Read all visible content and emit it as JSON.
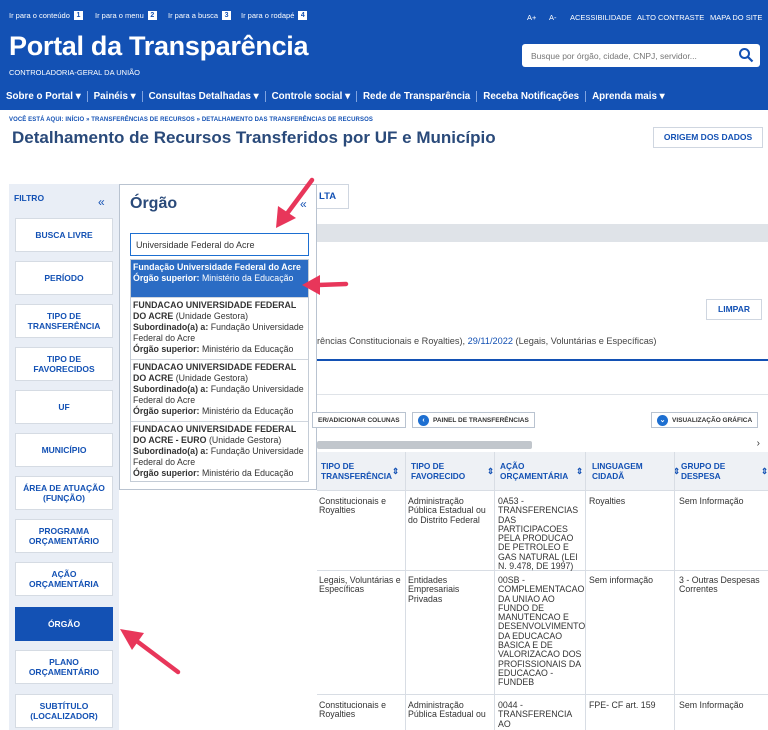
{
  "skip_links": [
    {
      "label": "Ir para o conteúdo",
      "key": "1"
    },
    {
      "label": "Ir para o menu",
      "key": "2"
    },
    {
      "label": "Ir para a busca",
      "key": "3"
    },
    {
      "label": "Ir para o rodapé",
      "key": "4"
    }
  ],
  "top_links": {
    "font_plus": "A+",
    "font_minus": "A-",
    "accessibility": "ACESSIBILIDADE",
    "contrast": "ALTO CONTRASTE",
    "sitemap": "MAPA DO SITE"
  },
  "brand": {
    "title": "Portal da Transparência",
    "org": "CONTROLADORIA-GERAL DA UNIÃO"
  },
  "search": {
    "placeholder": "Busque por órgão, cidade, CNPJ, servidor..."
  },
  "nav": [
    "Sobre o Portal",
    "Painéis",
    "Consultas Detalhadas",
    "Controle social",
    "Rede de Transparência",
    "Receba Notificações",
    "Aprenda mais"
  ],
  "breadcrumb": "VOCÊ ESTÁ AQUI: INÍCIO » TRANSFERÊNCIAS DE RECURSOS » DETALHAMENTO DAS TRANSFERÊNCIAS DE RECURSOS",
  "page_title": "Detalhamento de Recursos Transferidos por UF e Município",
  "origem_button": "ORIGEM DOS DADOS",
  "filter": {
    "title": "FILTRO",
    "items": [
      "BUSCA LIVRE",
      "PERÍODO",
      "TIPO DE TRANSFERÊNCIA",
      "TIPO DE FAVORECIDOS",
      "UF",
      "MUNICÍPIO",
      "ÁREA DE ATUAÇÃO (FUNÇÃO)",
      "PROGRAMA ORÇAMENTÁRIO",
      "AÇÃO ORÇAMENTÁRIA",
      "ÓRGÃO",
      "PLANO ORÇAMENTÁRIO",
      "SUBTÍTULO (LOCALIZADOR)"
    ],
    "active": "ÓRGÃO"
  },
  "orgao_panel": {
    "title": "Órgão",
    "input_value": "Universidade Federal do Acre",
    "options": [
      {
        "name": "Fundação Universidade Federal do Acre",
        "superior_label": "Órgão superior:",
        "superior": "Ministério da Educação",
        "selected": true
      },
      {
        "name": "FUNDACAO UNIVERSIDADE FEDERAL DO ACRE",
        "unit": "(Unidade Gestora)",
        "sub_label": "Subordinado(a) a:",
        "sub": "Fundação Universidade Federal do Acre",
        "superior_label": "Órgão superior:",
        "superior": "Ministério da Educação"
      },
      {
        "name": "FUNDACAO UNIVERSIDADE FEDERAL DO ACRE",
        "unit": "(Unidade Gestora)",
        "sub_label": "Subordinado(a) a:",
        "sub": "Fundação Universidade Federal do Acre",
        "superior_label": "Órgão superior:",
        "superior": "Ministério da Educação"
      },
      {
        "name": "FUNDACAO UNIVERSIDADE FEDERAL DO ACRE - EURO",
        "unit": "(Unidade Gestora)",
        "sub_label": "Subordinado(a) a:",
        "sub": "Fundação Universidade Federal do Acre",
        "superior_label": "Órgão superior:",
        "superior": "Ministério da Educação"
      }
    ]
  },
  "main": {
    "tab_label": "LTA",
    "limpar": "LIMPAR",
    "criteria_text": "rências Constitucionais e Royalties), ",
    "criteria_date": "29/11/2022",
    "criteria_rest": " (Legais, Voluntárias e Específicas)",
    "toolbar": {
      "columns": "ER/ADICIONAR COLUNAS",
      "panel": "PAINEL DE TRANSFERÊNCIAS",
      "graphic": "VISUALIZAÇÃO GRÁFICA"
    },
    "columns": [
      "TIPO DE TRANSFERÊNCIA",
      "TIPO DE FAVORECIDO",
      "AÇÃO ORÇAMENTÁRIA",
      "LINGUAGEM CIDADÃ",
      "GRUPO DE DESPESA"
    ],
    "rows": [
      [
        "Constitucionais e Royalties",
        "Administração Pública Estadual ou do Distrito Federal",
        "0A53 - TRANSFERENCIAS DAS PARTICIPACOES PELA PRODUCAO DE PETROLEO E GAS NATURAL (LEI N. 9.478, DE 1997)",
        "Royalties",
        "Sem Informação"
      ],
      [
        "Legais, Voluntárias e Específicas",
        "Entidades Empresariais Privadas",
        "00SB - COMPLEMENTACAO DA UNIAO AO FUNDO DE MANUTENCAO E DESENVOLVIMENTO DA EDUCACAO BASICA E DE VALORIZACAO DOS PROFISSIONAIS DA EDUCACAO - FUNDEB",
        "Sem informação",
        "3 - Outras Despesas Correntes"
      ],
      [
        "Constitucionais e Royalties",
        "Administração Pública Estadual ou",
        "0044 - TRANSFERENCIA AO",
        "FPE- CF art. 159",
        "Sem Informação"
      ]
    ]
  },
  "colors": {
    "header": "#1351b4",
    "accent": "#1351b4",
    "arrow": "#e8365a",
    "selected_option": "#2b6cc4"
  }
}
